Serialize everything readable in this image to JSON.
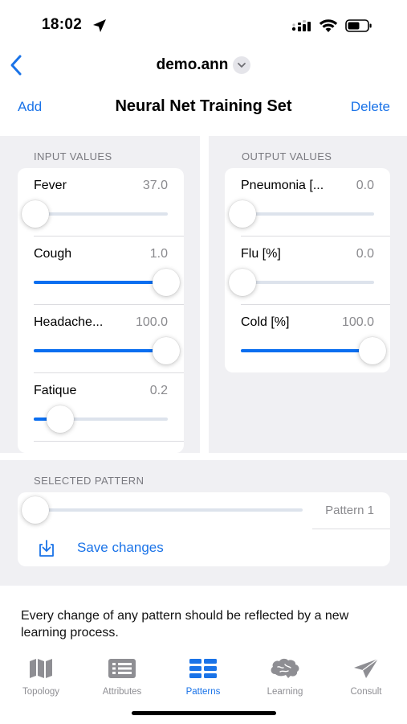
{
  "status": {
    "time": "18:02"
  },
  "nav": {
    "doc_title": "demo.ann"
  },
  "toolbar": {
    "add_label": "Add",
    "title": "Neural Net Training Set",
    "delete_label": "Delete"
  },
  "input": {
    "section_label": "INPUT VALUES",
    "rows": [
      {
        "label": "Fever",
        "value": "37.0",
        "level": 0.0
      },
      {
        "label": "Cough",
        "value": "1.0",
        "level": 1.0
      },
      {
        "label": "Headache...",
        "value": "100.0",
        "level": 1.0
      },
      {
        "label": "Fatique",
        "value": "0.2",
        "level": 0.2
      }
    ]
  },
  "output": {
    "section_label": "OUTPUT VALUES",
    "rows": [
      {
        "label": "Pneumonia [...",
        "value": "0.0",
        "level": 0.0
      },
      {
        "label": "Flu [%]",
        "value": "0.0",
        "level": 0.0
      },
      {
        "label": "Cold [%]",
        "value": "100.0",
        "level": 1.0
      }
    ]
  },
  "pattern": {
    "section_label": "SELECTED PATTERN",
    "current": "Pattern 1",
    "level": 0.0,
    "save_label": "Save changes"
  },
  "info_text": "Every change of any pattern should be reflected by a new learning process.",
  "tabs": [
    {
      "label": "Topology",
      "icon": "map-icon",
      "active": false
    },
    {
      "label": "Attributes",
      "icon": "list-icon",
      "active": false
    },
    {
      "label": "Patterns",
      "icon": "table-icon",
      "active": true
    },
    {
      "label": "Learning",
      "icon": "brain-icon",
      "active": false
    },
    {
      "label": "Consult",
      "icon": "send-icon",
      "active": false
    }
  ],
  "colors": {
    "accent": "#1a73e8",
    "slider_fill": "#0a6ef0",
    "panel_bg": "#f0f0f3",
    "inactive": "#8e8e93"
  }
}
